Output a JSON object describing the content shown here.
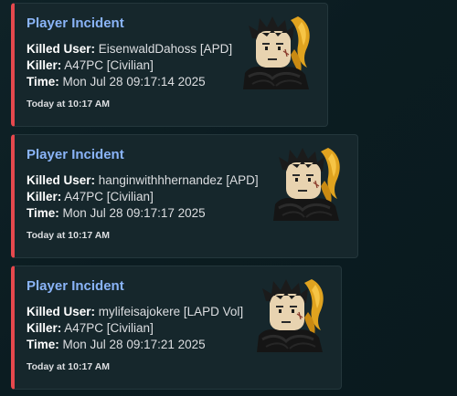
{
  "colors": {
    "accent_bar": "#e5484d",
    "title": "#8ab4f8",
    "embed_bg": "#16272c",
    "background": "#0d1f24"
  },
  "incidents": [
    {
      "title": "Player Incident",
      "killed_user_label": "Killed User:",
      "killed_user_value": "EisenwaldDahoss [APD]",
      "killer_label": "Killer:",
      "killer_value": "A47PC [Civilian]",
      "time_label": "Time:",
      "time_value": "Mon Jul 28 09:17:14 2025",
      "footer": "Today at 10:17 AM",
      "thumbnail_icon": "avatar-thumbnail-icon"
    },
    {
      "title": "Player Incident",
      "killed_user_label": "Killed User:",
      "killed_user_value": "hanginwithhhernandez [APD]",
      "killer_label": "Killer:",
      "killer_value": "A47PC [Civilian]",
      "time_label": "Time:",
      "time_value": "Mon Jul 28 09:17:17 2025",
      "footer": "Today at 10:17 AM",
      "thumbnail_icon": "avatar-thumbnail-icon"
    },
    {
      "title": "Player Incident",
      "killed_user_label": "Killed User:",
      "killed_user_value": "mylifeisajokere [LAPD Vol]",
      "killer_label": "Killer:",
      "killer_value": "A47PC [Civilian]",
      "time_label": "Time:",
      "time_value": "Mon Jul 28 09:17:21 2025",
      "footer": "Today at 10:17 AM",
      "thumbnail_icon": "avatar-thumbnail-icon"
    }
  ]
}
